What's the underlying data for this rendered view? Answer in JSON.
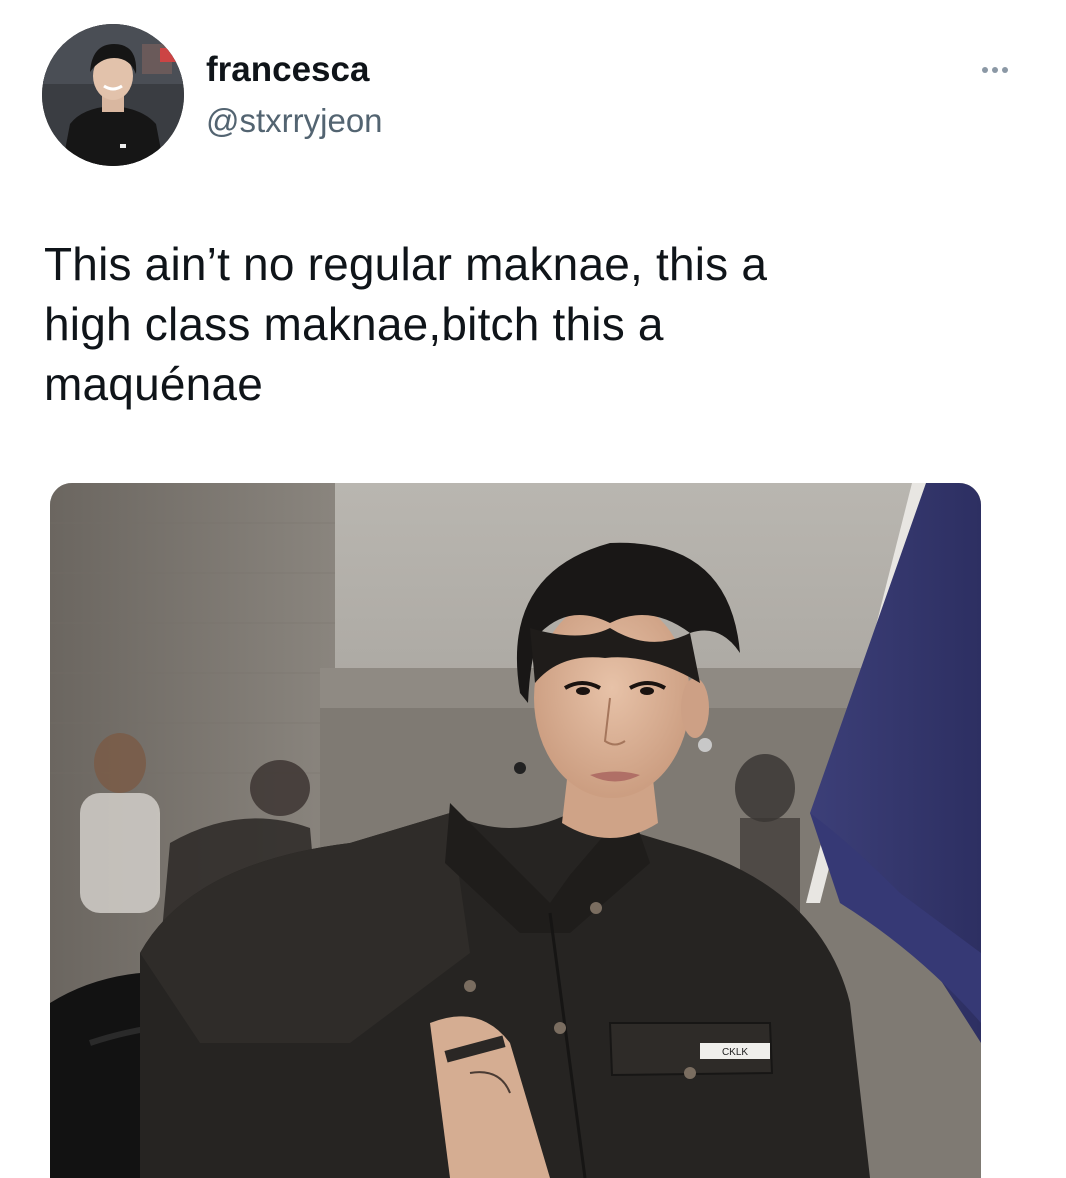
{
  "tweet": {
    "author": {
      "display_name": "francesca",
      "handle": "@stxrryjeon",
      "avatar_icon": "profile-photo"
    },
    "more_icon": "more-options-icon",
    "text_lines": [
      "This ain’t no regular maknae, this a",
      "high class maknae,bitch this a",
      "maquénae"
    ],
    "media": {
      "type": "photo",
      "jacket_label": "CKLK"
    }
  },
  "colors": {
    "text_primary": "#0f1419",
    "text_secondary": "#536471"
  }
}
